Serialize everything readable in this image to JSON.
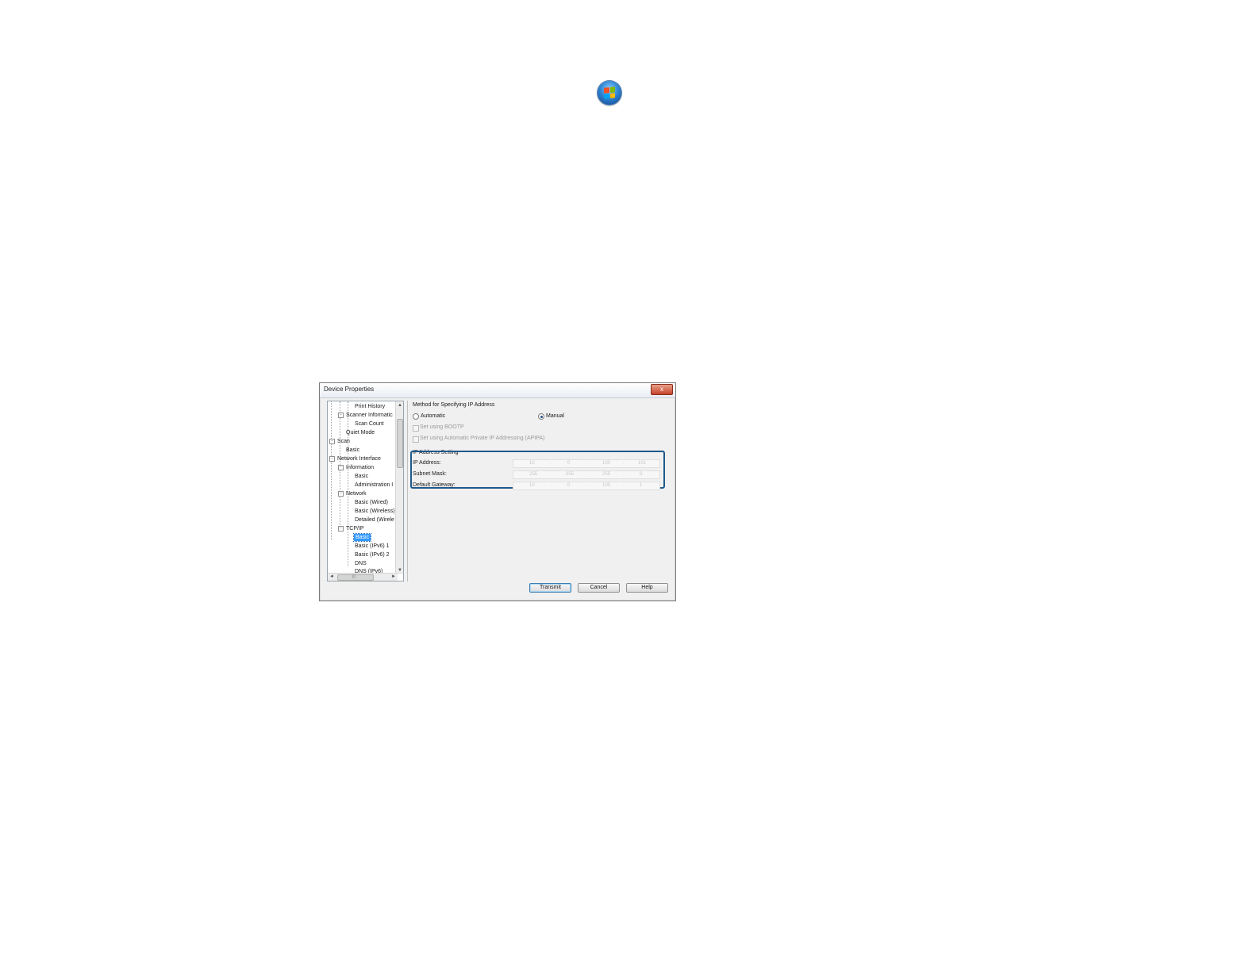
{
  "dialog": {
    "title": "Device Properties",
    "close_label": "x"
  },
  "tree": {
    "items": [
      {
        "label": "Print History"
      },
      {
        "label": "Scanner Informatic",
        "expander": "⊟"
      },
      {
        "label": "Scan Count"
      },
      {
        "label": "Quiet Mode"
      },
      {
        "label": "Scan",
        "expander": "⊟"
      },
      {
        "label": "Basic"
      },
      {
        "label": "Network Interface",
        "expander": "⊟"
      },
      {
        "label": "Information",
        "expander": "⊟"
      },
      {
        "label": "Basic"
      },
      {
        "label": "Administration I"
      },
      {
        "label": "Network",
        "expander": "⊟"
      },
      {
        "label": "Basic (Wired)"
      },
      {
        "label": "Basic (Wireless)"
      },
      {
        "label": "Detailed (Wirele"
      },
      {
        "label": "TCP/IP",
        "expander": "⊟"
      },
      {
        "label": "Basic",
        "selected": true
      },
      {
        "label": "Basic (IPv6) 1"
      },
      {
        "label": "Basic (IPv6) 2"
      },
      {
        "label": "DNS"
      },
      {
        "label": "DNS (IPv6)"
      }
    ],
    "scroll_up": "▲",
    "scroll_down": "▼",
    "scroll_left": "◄",
    "scroll_right": "►",
    "scroll_grip": "|||"
  },
  "method": {
    "heading": "Method for Specifying IP Address",
    "automatic_label": "Automatic",
    "manual_label": "Manual",
    "selected": "manual",
    "bootp_label": "Set using BOOTP",
    "apipa_label": "Set using Automatic Private IP Addressing (APIPA)"
  },
  "ip_setting": {
    "heading": "IP Address Setting",
    "fields": [
      {
        "label": "IP Address:",
        "octets": [
          "10",
          "0",
          "100",
          "101"
        ]
      },
      {
        "label": "Subnet Mask:",
        "octets": [
          "255",
          "255",
          "255",
          "0"
        ]
      },
      {
        "label": "Default Gateway:",
        "octets": [
          "10",
          "0",
          "100",
          "1"
        ]
      }
    ]
  },
  "buttons": {
    "transmit": "Transmit",
    "cancel": "Cancel",
    "help": "Help"
  },
  "colors": {
    "highlight_border": "#1e5a8c",
    "selection": "#3399ff"
  }
}
